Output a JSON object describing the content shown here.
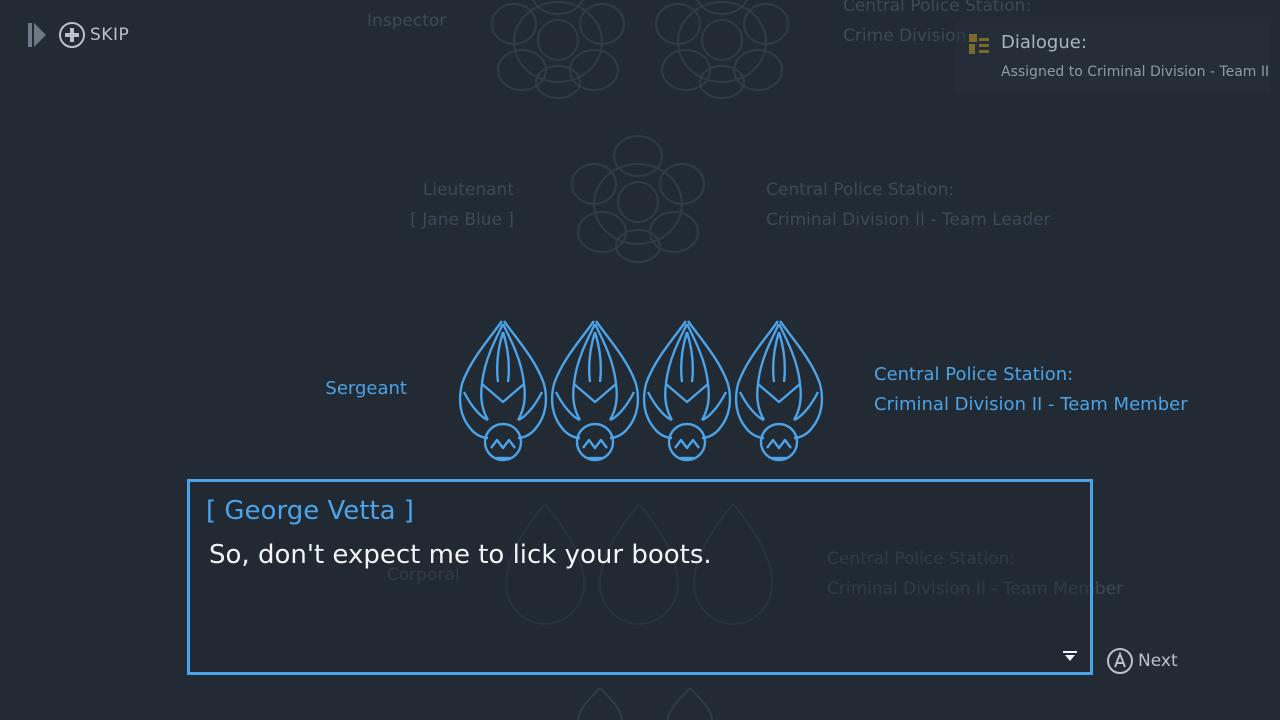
{
  "skip": {
    "label": "SKIP",
    "icons": [
      "skip-forward-icon",
      "plus-button-icon"
    ]
  },
  "objective": {
    "icon": "document-icon",
    "title": "Dialogue:",
    "text": "Assigned to Criminal Division - Team II"
  },
  "background_ranks": {
    "inspector": {
      "rank": "Inspector",
      "station_line1": "Central Police Station:",
      "station_line2": "Crime Division"
    },
    "lieutenant": {
      "rank": "Lieutenant",
      "name": "[ Jane Blue ]",
      "station_line1": "Central Police Station:",
      "station_line2": "Criminal Division II - Team Leader"
    },
    "corporal": {
      "rank": "Corporal",
      "station_line1": "Central Police Station:",
      "station_line2": "Criminal Division II - Team Member"
    }
  },
  "sergeant": {
    "rank": "Sergeant",
    "badge_count": 4,
    "station_line1": "Central Police Station:",
    "station_line2": "Criminal Division II - Team Member"
  },
  "dialogue": {
    "speaker": "[ George Vetta ]",
    "line": "So, don't expect me to lick your boots."
  },
  "next": {
    "label": "Next",
    "icon": "a-button-icon"
  },
  "colors": {
    "background": "#222a33",
    "accent": "#4da3e8",
    "faded": "#3c4a58",
    "dialogue_text": "#f2f4f6",
    "ui_text": "#b9c2cb"
  }
}
